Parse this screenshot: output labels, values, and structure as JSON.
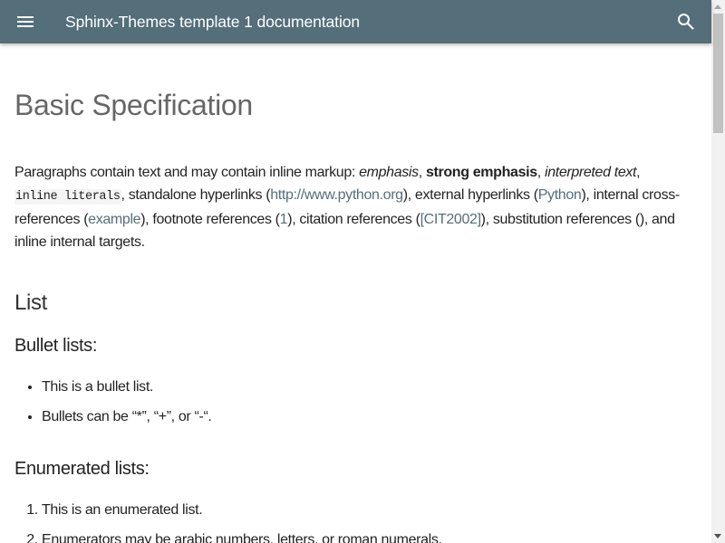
{
  "header": {
    "title": "Sphinx-Themes template 1 documentation",
    "menu_icon": "menu-icon",
    "search_icon": "search-icon",
    "color": "#546e7a"
  },
  "page": {
    "title": "Basic Specification",
    "paragraph": {
      "t1": "Paragraphs contain text and may contain inline markup: ",
      "emphasis": "emphasis",
      "c1": ", ",
      "strong": "strong emphasis",
      "c2": ", ",
      "interpreted": "interpreted text",
      "c3": ",",
      "literal": "inline literals",
      "t2": ", standalone hyperlinks (",
      "link_python_org": "http://www.python.org",
      "t3": "), external hyperlinks (",
      "link_python": "Python",
      "t4": "), internal cross-references (",
      "link_example": "example",
      "t5": "), footnote references (",
      "link_footnote": "1",
      "t6": "), citation references (",
      "link_citation": "[CIT2002]",
      "t7": "), substitution references (), and inline internal targets."
    },
    "list_heading": "List",
    "bullet_heading": "Bullet lists:",
    "bullets": [
      "This is a bullet list.",
      "Bullets can be “*”, “+”, or “-“."
    ],
    "enum_heading": "Enumerated lists:",
    "enumerated": [
      "This is an enumerated list.",
      "Enumerators may be arabic numbers, letters, or roman numerals."
    ]
  }
}
